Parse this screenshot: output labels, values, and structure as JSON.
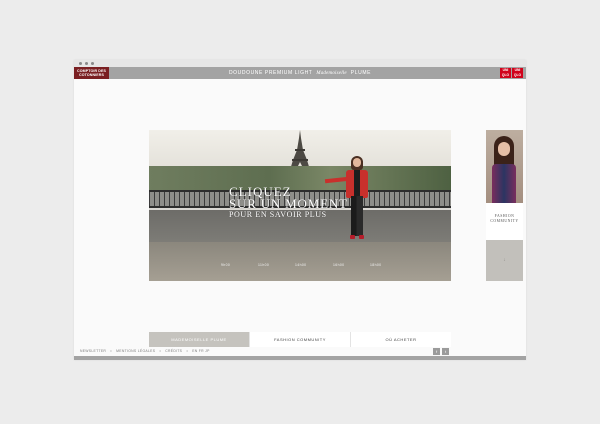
{
  "brand": {
    "left_logo_line1": "COMPTOIR DES",
    "left_logo_line2": "COTONNIERS",
    "right_logo_top": "UNI QLO",
    "right_logo_bottom": "UNI QLO"
  },
  "header": {
    "title_prefix": "DOUDOUNE PREMIUM LIGHT",
    "title_script": "Mademoiselle",
    "title_suffix": "PLUME"
  },
  "hero": {
    "line1": "CLIQUEZ",
    "line2": "SUR UN MOMENT",
    "line3": "POUR EN SAVOIR PLUS",
    "timeline": [
      "9h00",
      "11h00",
      "14h00",
      "16h00",
      "18h00"
    ]
  },
  "side": {
    "caption_line1": "FASHION",
    "caption_line2": "COMMUNITY",
    "arrow": "↓"
  },
  "tabs": [
    {
      "label": "MADEMOISELLE PLUME",
      "active": true
    },
    {
      "label": "FASHION COMMUNITY",
      "active": false
    },
    {
      "label": "OÙ ACHETER",
      "active": false
    }
  ],
  "footer": {
    "links": [
      "NEWSLETTER",
      "•",
      "MENTIONS LÉGALES",
      "•",
      "CRÉDITS",
      "•",
      "EN  FR  JP"
    ],
    "btn1": "f",
    "btn2": "t"
  },
  "colors": {
    "brand_red": "#7a1f22",
    "uniqlo_red": "#d0021b",
    "bar_gray": "#a3a3a3",
    "jacket_red": "#c9302c"
  }
}
